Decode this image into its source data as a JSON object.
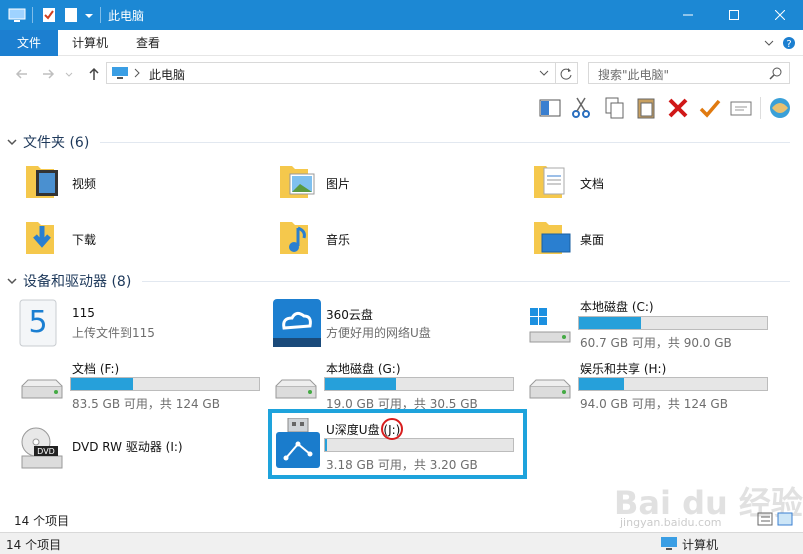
{
  "window": {
    "title": "此电脑"
  },
  "ribbon": {
    "tabs": [
      "文件",
      "计算机",
      "查看"
    ]
  },
  "address": {
    "path": "此电脑",
    "search_placeholder": "搜索\"此电脑\""
  },
  "folders": {
    "header": "文件夹 (6)",
    "items": [
      {
        "name": "视频",
        "icon": "video-folder-icon"
      },
      {
        "name": "图片",
        "icon": "pictures-folder-icon"
      },
      {
        "name": "文档",
        "icon": "documents-folder-icon"
      },
      {
        "name": "下载",
        "icon": "downloads-folder-icon"
      },
      {
        "name": "音乐",
        "icon": "music-folder-icon"
      },
      {
        "name": "桌面",
        "icon": "desktop-folder-icon"
      }
    ]
  },
  "drives": {
    "header": "设备和驱动器 (8)",
    "items": [
      {
        "name": "115",
        "sub": "上传文件到115",
        "icon": "115-cloud-icon"
      },
      {
        "name": "360云盘",
        "sub": "方便好用的网络U盘",
        "icon": "360-cloud-icon"
      },
      {
        "name": "本地磁盘 (C:)",
        "sub": "60.7 GB 可用，共 90.0 GB",
        "used_fraction": 0.33,
        "icon": "windows-drive-icon"
      },
      {
        "name": "文档 (F:)",
        "sub": "83.5 GB 可用，共 124 GB",
        "used_fraction": 0.33,
        "icon": "hard-drive-icon"
      },
      {
        "name": "本地磁盘 (G:)",
        "sub": "19.0 GB 可用，共 30.5 GB",
        "used_fraction": 0.38,
        "icon": "hard-drive-icon"
      },
      {
        "name": "娱乐和共享 (H:)",
        "sub": "94.0 GB 可用，共 124 GB",
        "used_fraction": 0.24,
        "icon": "hard-drive-icon"
      },
      {
        "name": "DVD RW 驱动器 (I:)",
        "icon": "dvd-drive-icon"
      },
      {
        "name": "U深度U盘 (J:)",
        "sub": "3.18 GB 可用，共 3.20 GB",
        "used_fraction": 0.01,
        "icon": "usb-drive-icon"
      }
    ]
  },
  "status": {
    "count_top": "14 个项目",
    "count_bottom": "14 个项目",
    "location": "计算机"
  },
  "watermark": {
    "text": "Bai du 经验",
    "sub": "jingyan.baidu.com"
  },
  "colors": {
    "titlebar": "#1c88d4",
    "accent": "#26a0da",
    "highlight": "#1ea3dc",
    "mark": "#d81e1e"
  }
}
